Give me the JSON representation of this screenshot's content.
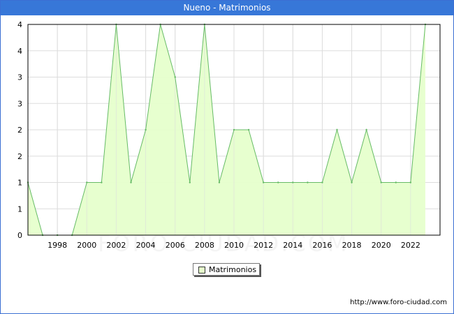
{
  "window": {
    "title": "Nueno - Matrimonios"
  },
  "watermark": "FORO-CIUDAD.COM",
  "footer": {
    "url": "http://www.foro-ciudad.com"
  },
  "colors": {
    "fill": "#e6ffcc",
    "line": "#66bb66",
    "titlebar": "#3777d8",
    "grid": "#dddddd"
  },
  "chart_data": {
    "type": "area",
    "x": [
      1996,
      1997,
      1998,
      1999,
      2000,
      2001,
      2002,
      2003,
      2004,
      2005,
      2006,
      2007,
      2008,
      2009,
      2010,
      2011,
      2012,
      2013,
      2014,
      2015,
      2016,
      2017,
      2018,
      2019,
      2020,
      2021,
      2022,
      2023
    ],
    "series": [
      {
        "name": "Matrimonios",
        "values": [
          1,
          0,
          0,
          0,
          1,
          1,
          4,
          1,
          2,
          4,
          3,
          1,
          4,
          1,
          2,
          2,
          1,
          1,
          1,
          1,
          1,
          2,
          1,
          2,
          1,
          1,
          1,
          4
        ]
      }
    ],
    "x_ticks": [
      "1998",
      "2000",
      "2002",
      "2004",
      "2006",
      "2008",
      "2010",
      "2012",
      "2014",
      "2016",
      "2018",
      "2020",
      "2022"
    ],
    "y_tick_labels": [
      "0",
      "1",
      "1",
      "2",
      "2",
      "3",
      "3",
      "4",
      "4"
    ],
    "xlim": [
      1996,
      2024
    ],
    "ylim": [
      0,
      4
    ],
    "grid": true,
    "legend": "bottom-center"
  }
}
